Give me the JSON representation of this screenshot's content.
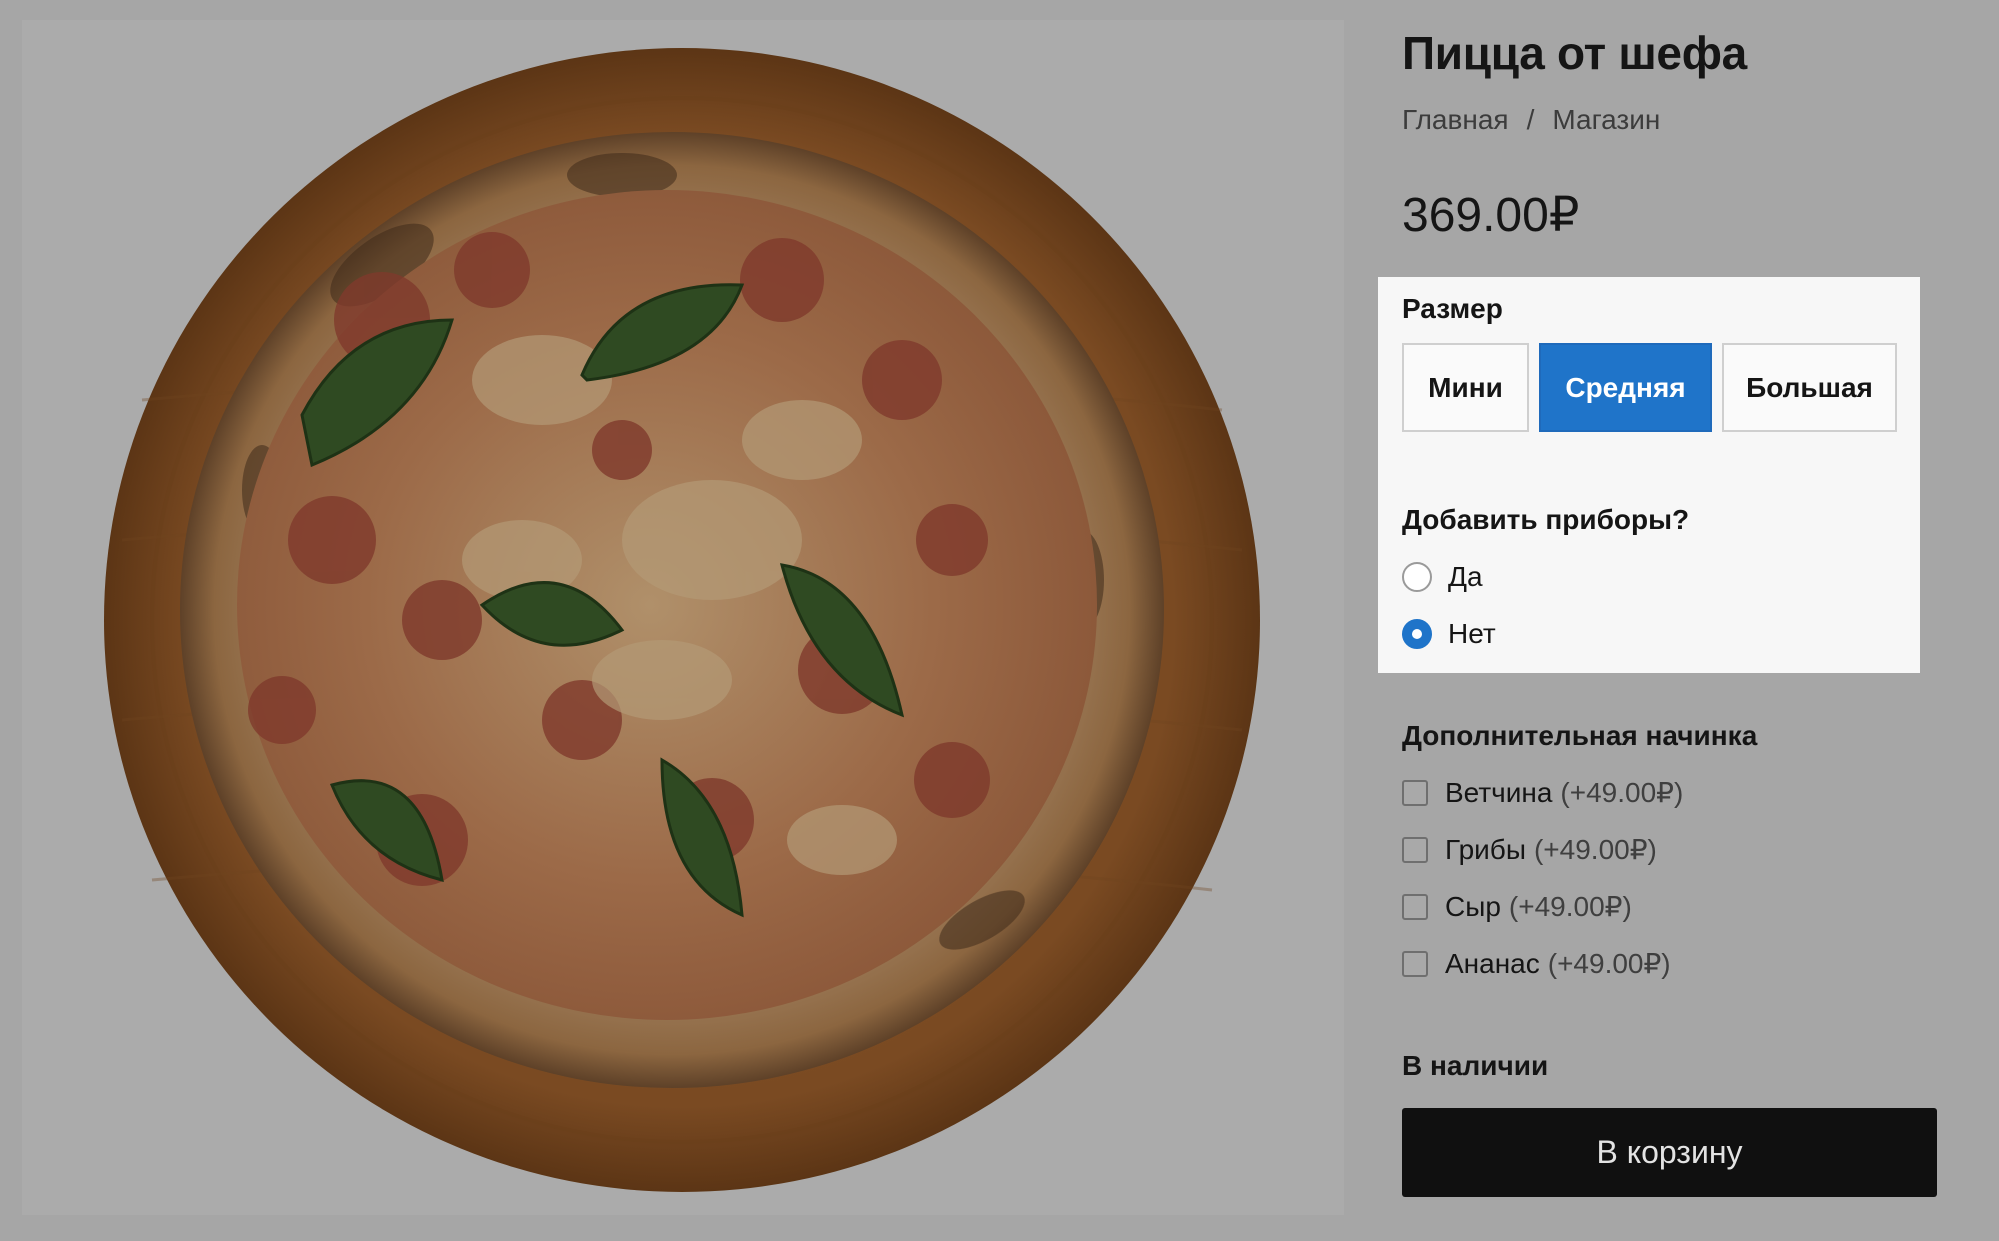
{
  "product": {
    "title": "Пицца от шефа",
    "price": "369.00₽",
    "image": "pizza-photo",
    "availability": "В наличии"
  },
  "breadcrumb": {
    "items": [
      "Главная",
      "Магазин"
    ],
    "separator": "/"
  },
  "size": {
    "label": "Размер",
    "options": [
      "Мини",
      "Средняя",
      "Большая"
    ],
    "selected": "Средняя"
  },
  "cutlery": {
    "label": "Добавить приборы?",
    "options": [
      "Да",
      "Нет"
    ],
    "selected": "Нет"
  },
  "toppings": {
    "label": "Дополнительная начинка",
    "items": [
      {
        "name": "Ветчина",
        "price": "(+49.00₽)",
        "checked": false
      },
      {
        "name": "Грибы",
        "price": "(+49.00₽)",
        "checked": false
      },
      {
        "name": "Сыр",
        "price": "(+49.00₽)",
        "checked": false
      },
      {
        "name": "Ананас",
        "price": "(+49.00₽)",
        "checked": false
      }
    ]
  },
  "cart_button": {
    "label": "В корзину"
  },
  "colors": {
    "accent": "#1f74c9",
    "overlay": "#a6a6a6",
    "cart_button_bg": "#101010"
  }
}
